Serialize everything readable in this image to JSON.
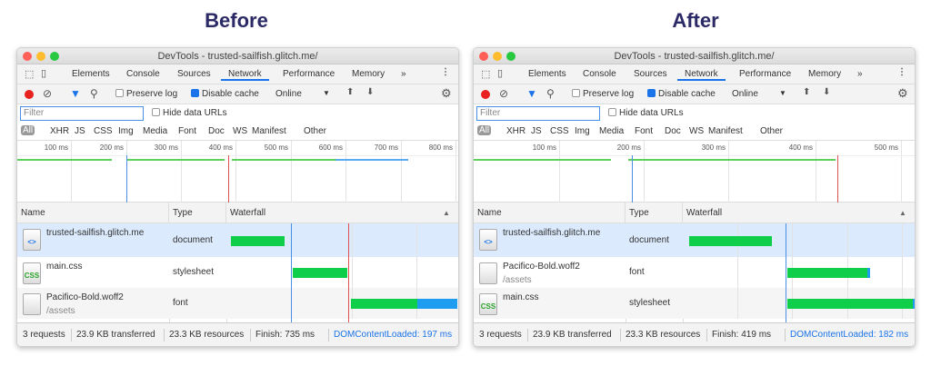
{
  "headings": {
    "before": "Before",
    "after": "After"
  },
  "colors": {
    "heading": "#2b2966",
    "accent": "#1a73e8",
    "green": "#0fcf4a",
    "blue_line": "#4a90e2",
    "red_line": "#e05050"
  },
  "panels": [
    {
      "title": "DevTools - trusted-sailfish.glitch.me/",
      "tabs": [
        "Elements",
        "Console",
        "Sources",
        "Network",
        "Performance",
        "Memory",
        "»"
      ],
      "active_tab": "Network",
      "toolbar": {
        "preserve_log": "Preserve log",
        "preserve_log_checked": false,
        "disable_cache": "Disable cache",
        "disable_cache_checked": true,
        "throttle": "Online"
      },
      "filter": {
        "placeholder": "Filter",
        "hide_data_urls": "Hide data URLs"
      },
      "types": [
        "All",
        "XHR",
        "JS",
        "CSS",
        "Img",
        "Media",
        "Font",
        "Doc",
        "WS",
        "Manifest",
        "Other"
      ],
      "ticks": [
        "100 ms",
        "200 ms",
        "300 ms",
        "400 ms",
        "500 ms",
        "600 ms",
        "700 ms",
        "800 ms"
      ],
      "columns": {
        "name": "Name",
        "type": "Type",
        "waterfall": "Waterfall"
      },
      "rows": [
        {
          "name": "trusted-sailfish.glitch.me",
          "path": "",
          "type": "document",
          "icon": "html-file-icon",
          "selected": true
        },
        {
          "name": "main.css",
          "path": "",
          "type": "stylesheet",
          "icon": "css-file-icon"
        },
        {
          "name": "Pacifico-Bold.woff2",
          "path": "/assets",
          "type": "font",
          "icon": "generic-file-icon"
        }
      ],
      "status": {
        "requests": "3 requests",
        "transferred": "23.9 KB transferred",
        "resources": "23.3 KB resources",
        "finish": "Finish: 735 ms",
        "dcl": "DOMContentLoaded: 197 ms"
      }
    },
    {
      "title": "DevTools - trusted-sailfish.glitch.me/",
      "tabs": [
        "Elements",
        "Console",
        "Sources",
        "Network",
        "Performance",
        "Memory",
        "»"
      ],
      "active_tab": "Network",
      "toolbar": {
        "preserve_log": "Preserve log",
        "preserve_log_checked": false,
        "disable_cache": "Disable cache",
        "disable_cache_checked": true,
        "throttle": "Online"
      },
      "filter": {
        "placeholder": "Filter",
        "hide_data_urls": "Hide data URLs"
      },
      "types": [
        "All",
        "XHR",
        "JS",
        "CSS",
        "Img",
        "Media",
        "Font",
        "Doc",
        "WS",
        "Manifest",
        "Other"
      ],
      "ticks": [
        "100 ms",
        "200 ms",
        "300 ms",
        "400 ms",
        "500 ms"
      ],
      "columns": {
        "name": "Name",
        "type": "Type",
        "waterfall": "Waterfall"
      },
      "rows": [
        {
          "name": "trusted-sailfish.glitch.me",
          "path": "",
          "type": "document",
          "icon": "html-file-icon",
          "selected": true
        },
        {
          "name": "Pacifico-Bold.woff2",
          "path": "/assets",
          "type": "font",
          "icon": "generic-file-icon"
        },
        {
          "name": "main.css",
          "path": "",
          "type": "stylesheet",
          "icon": "css-file-icon"
        }
      ],
      "status": {
        "requests": "3 requests",
        "transferred": "23.9 KB transferred",
        "resources": "23.3 KB resources",
        "finish": "Finish: 419 ms",
        "dcl": "DOMContentLoaded: 182 ms"
      }
    }
  ]
}
